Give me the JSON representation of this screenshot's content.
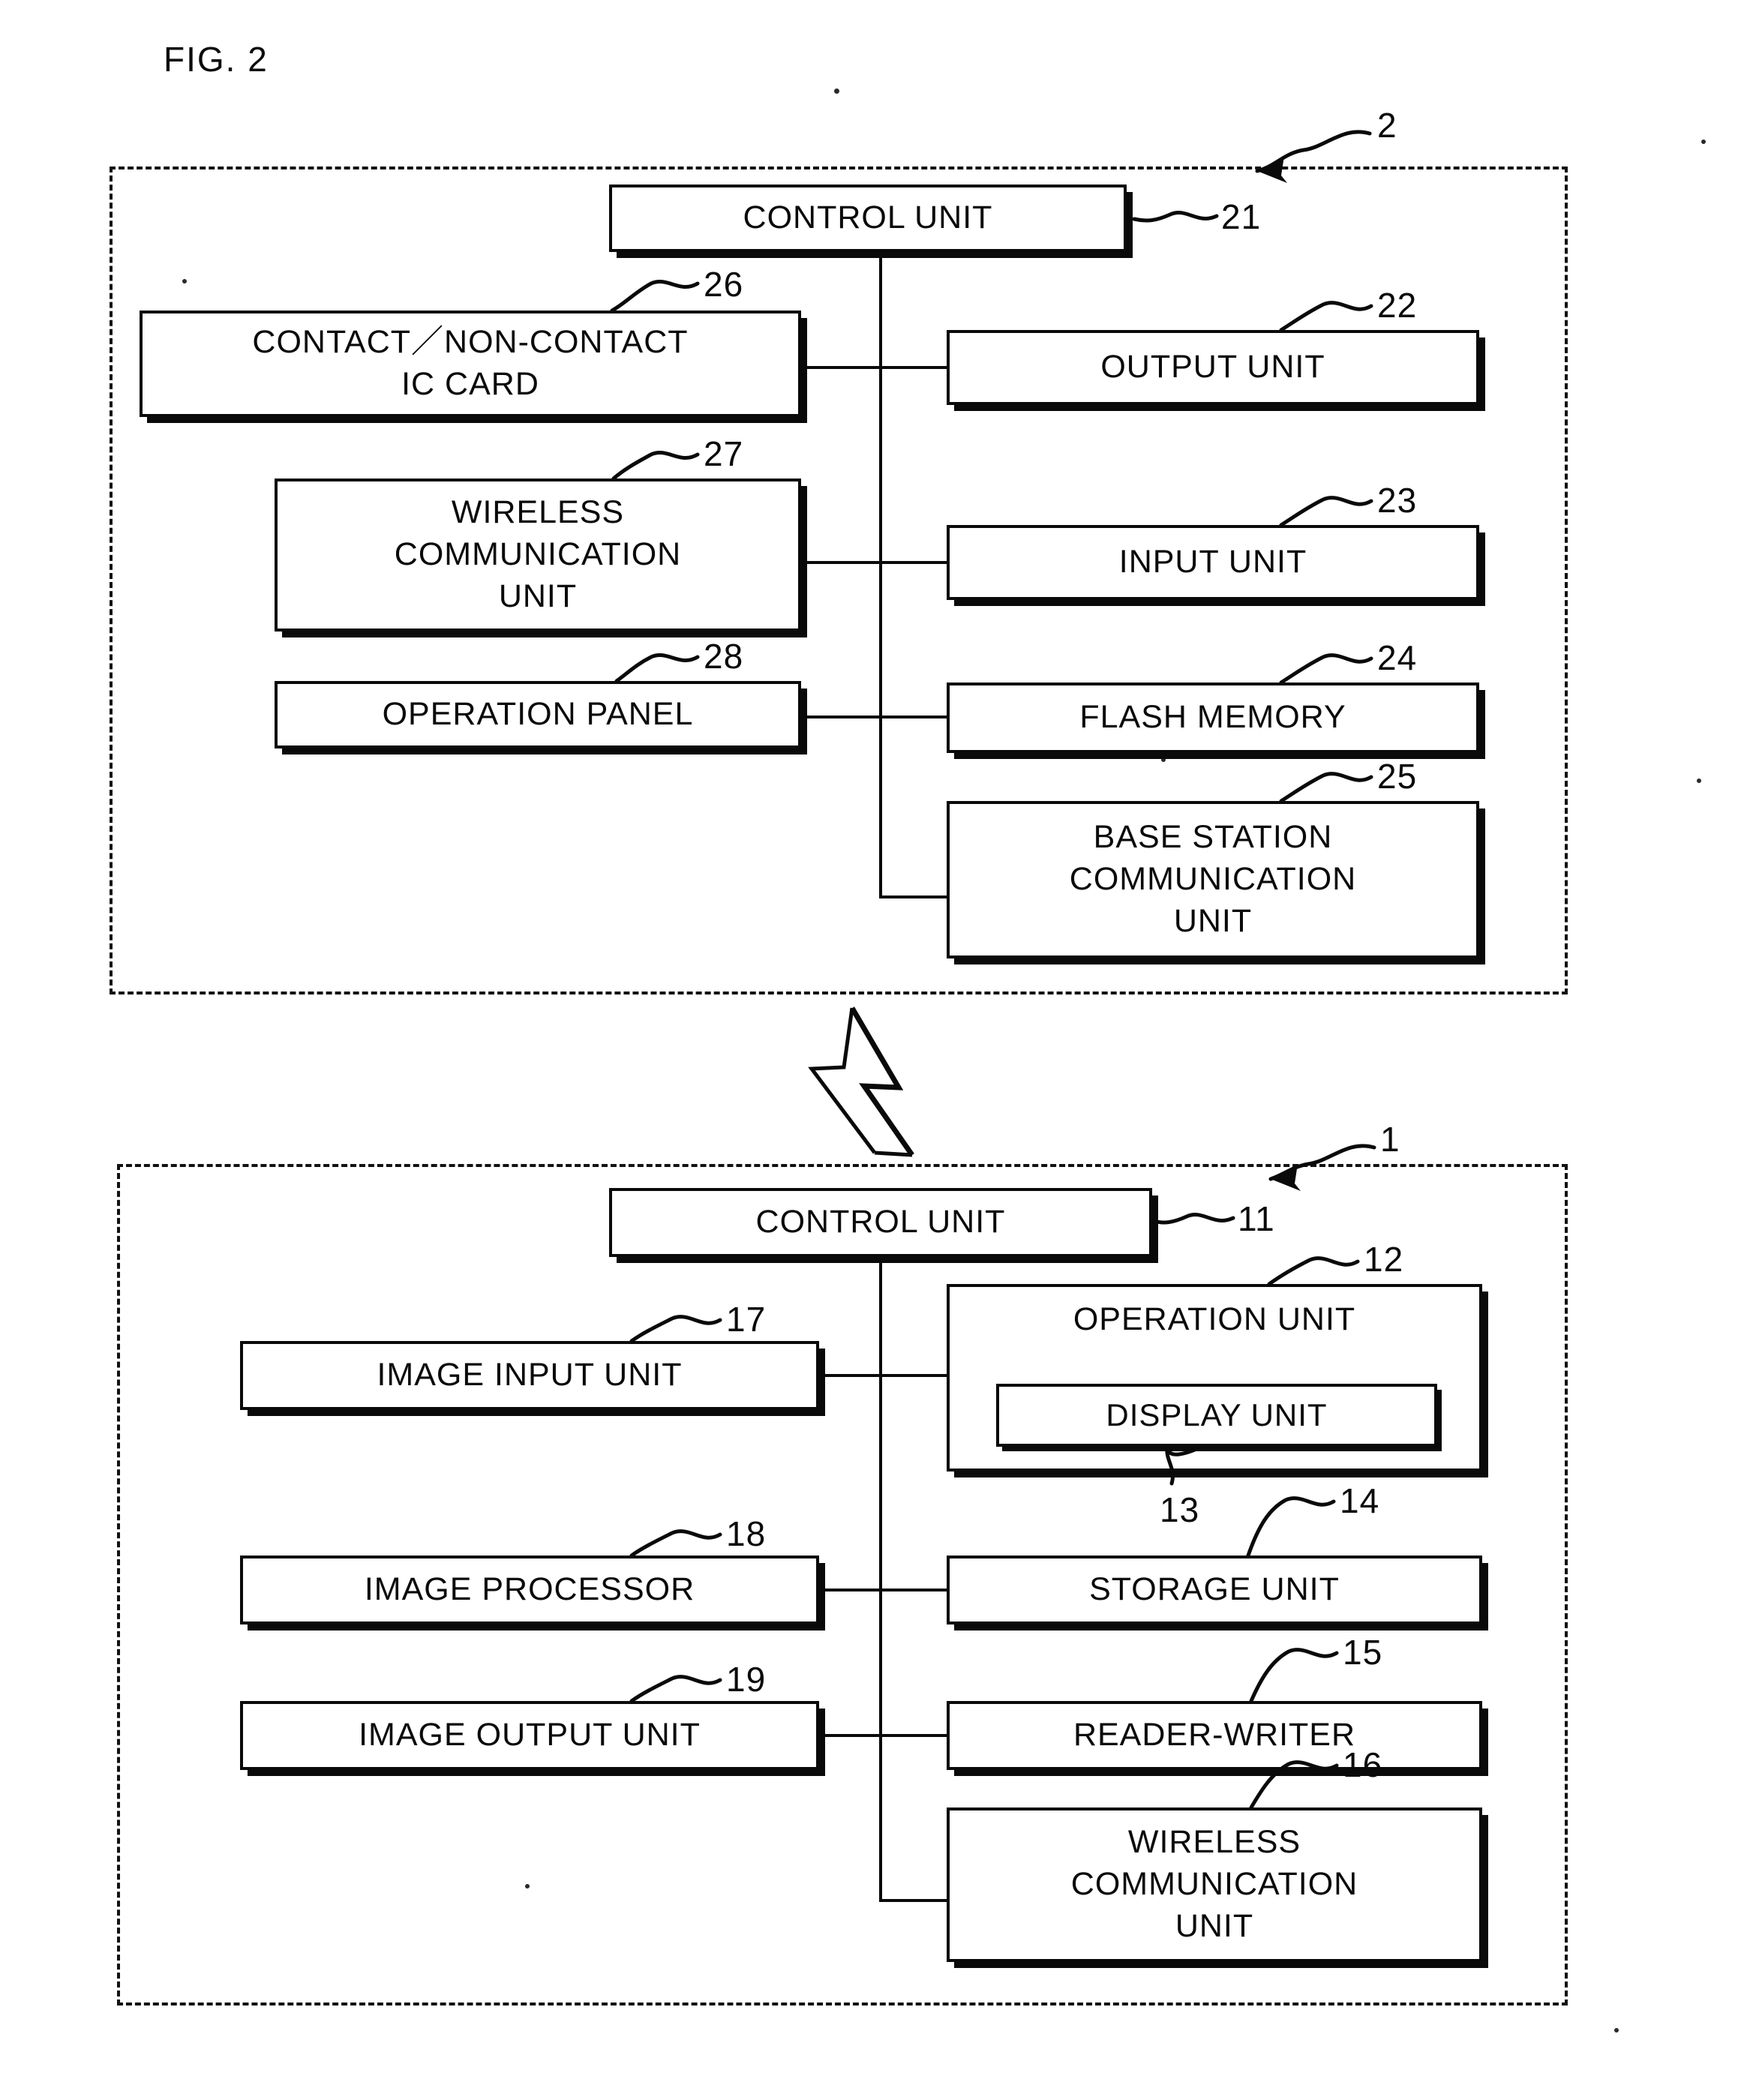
{
  "figure": {
    "label": "FIG. 2",
    "type": "block-diagram"
  },
  "enclosures": [
    {
      "id": "terminal",
      "ref": "2",
      "label": ""
    },
    {
      "id": "device",
      "ref": "1",
      "label": ""
    }
  ],
  "terminal_block": {
    "ref": "2",
    "control_unit": {
      "label": "CONTROL  UNIT",
      "ref": "21"
    },
    "left_column": [
      {
        "label": "CONTACT／NON-CONTACT\nIC  CARD",
        "ref": "26"
      },
      {
        "label": "WIRELESS\nCOMMUNICATION\nUNIT",
        "ref": "27"
      },
      {
        "label": "OPERATION  PANEL",
        "ref": "28"
      }
    ],
    "right_column": [
      {
        "label": "OUTPUT  UNIT",
        "ref": "22"
      },
      {
        "label": "INPUT  UNIT",
        "ref": "23"
      },
      {
        "label": "FLASH  MEMORY",
        "ref": "24"
      },
      {
        "label": "BASE  STATION\nCOMMUNICATION\nUNIT",
        "ref": "25"
      }
    ]
  },
  "device_block": {
    "ref": "1",
    "control_unit": {
      "label": "CONTROL  UNIT",
      "ref": "11"
    },
    "left_column": [
      {
        "label": "IMAGE  INPUT  UNIT",
        "ref": "17"
      },
      {
        "label": "IMAGE  PROCESSOR",
        "ref": "18"
      },
      {
        "label": "IMAGE  OUTPUT  UNIT",
        "ref": "19"
      }
    ],
    "right_column": [
      {
        "label": "OPERATION  UNIT",
        "ref": "12"
      },
      {
        "label": "STORAGE  UNIT",
        "ref": "14"
      },
      {
        "label": "READER-WRITER",
        "ref": "15"
      },
      {
        "label": "WIRELESS\nCOMMUNICATION\nUNIT",
        "ref": "16"
      }
    ],
    "display_unit": {
      "label": "DISPLAY  UNIT",
      "ref": "13"
    }
  },
  "link": {
    "symbol": "lightning-bolt",
    "meaning": "wireless link between block 2 and block 1"
  },
  "colors": {
    "ink": "#0a0a0a",
    "paper": "#ffffff"
  }
}
